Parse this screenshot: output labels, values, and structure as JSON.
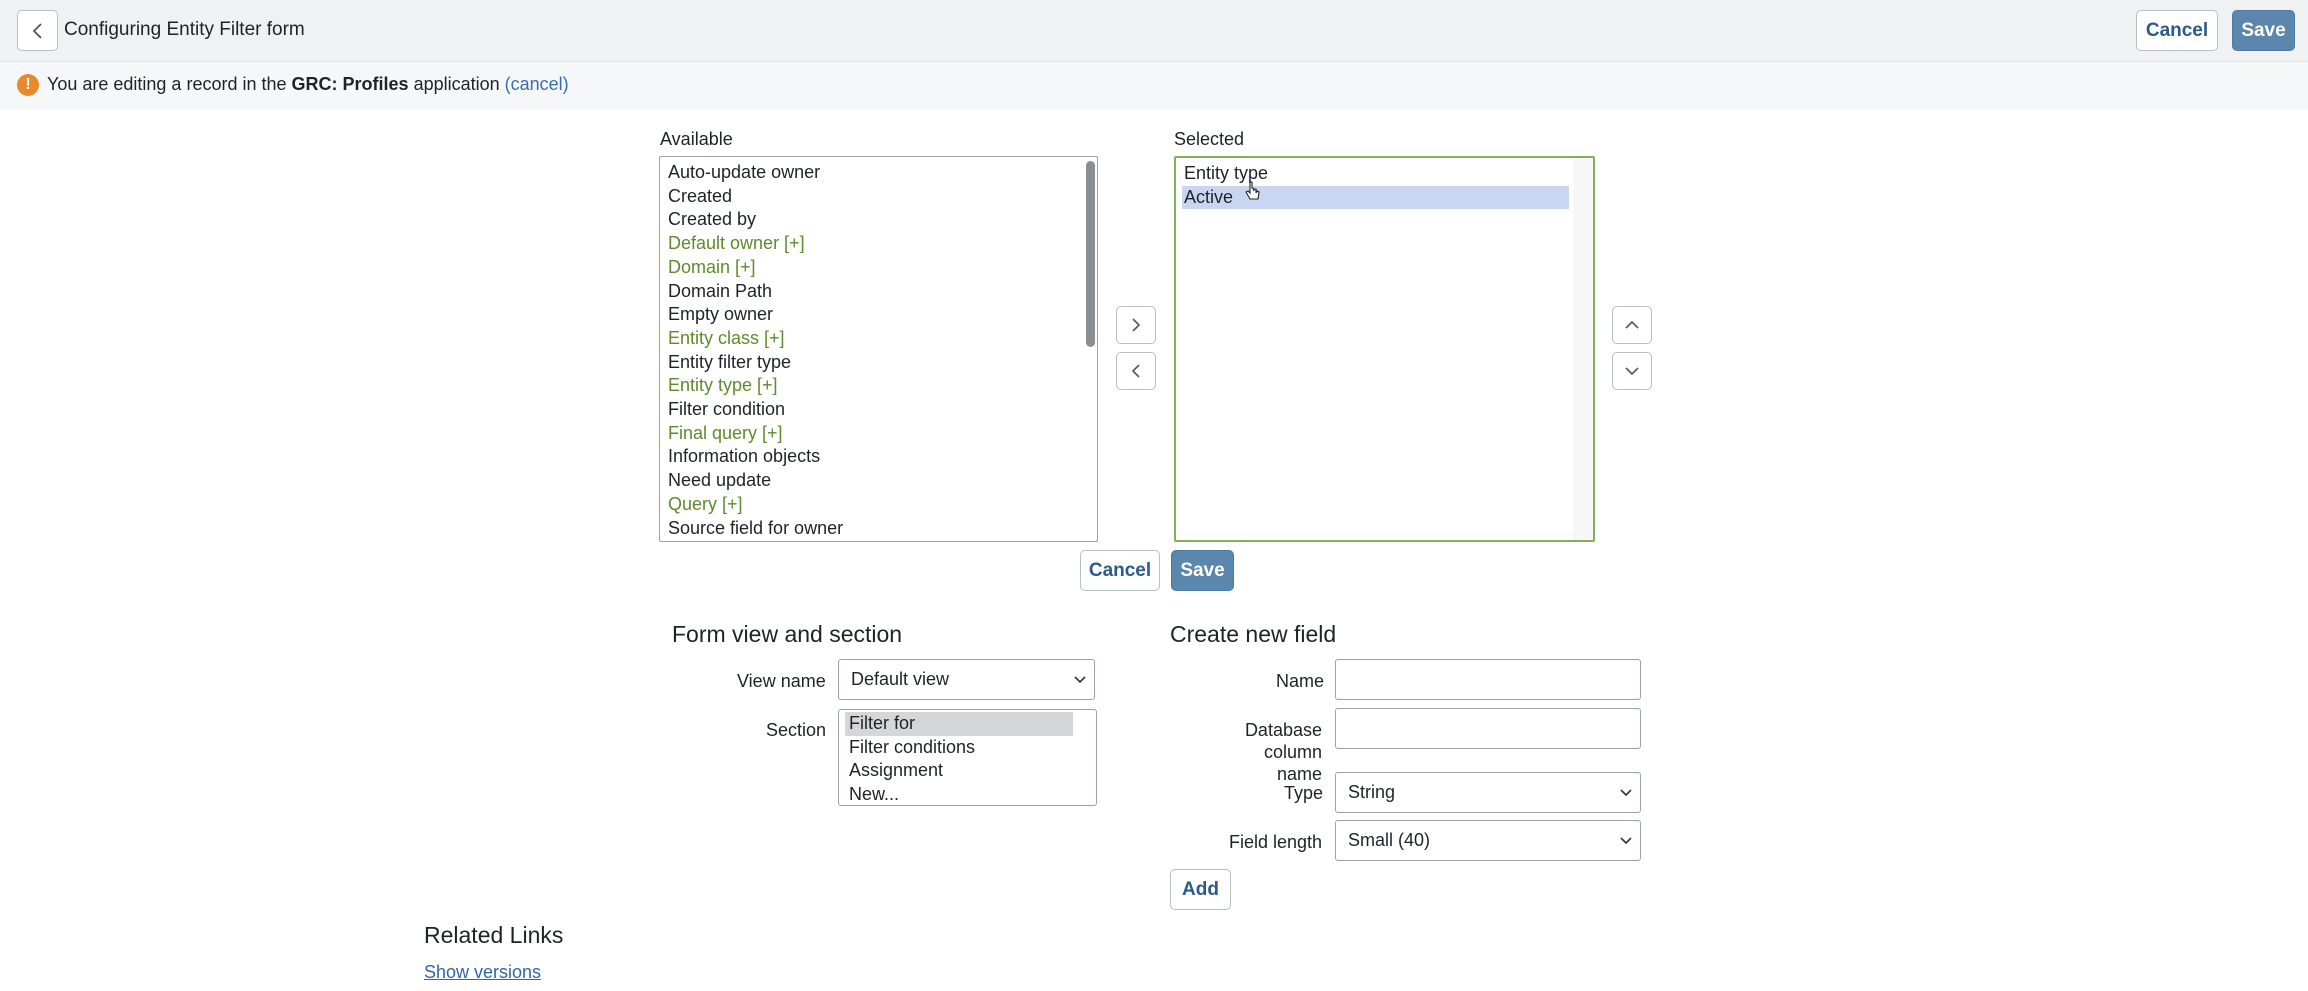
{
  "header": {
    "title": "Configuring Entity Filter form",
    "cancel_label": "Cancel",
    "save_label": "Save"
  },
  "notice": {
    "prefix": "You are editing a record in the",
    "app_name": "GRC: Profiles",
    "suffix": "application",
    "cancel_link": "(cancel)"
  },
  "slushbucket": {
    "available_label": "Available",
    "selected_label": "Selected",
    "available_items": [
      {
        "label": "Auto-update owner",
        "reference": false
      },
      {
        "label": "Created",
        "reference": false
      },
      {
        "label": "Created by",
        "reference": false
      },
      {
        "label": "Default owner [+]",
        "reference": true
      },
      {
        "label": "Domain [+]",
        "reference": true
      },
      {
        "label": "Domain Path",
        "reference": false
      },
      {
        "label": "Empty owner",
        "reference": false
      },
      {
        "label": "Entity class [+]",
        "reference": true
      },
      {
        "label": "Entity filter type",
        "reference": false
      },
      {
        "label": "Entity type [+]",
        "reference": true
      },
      {
        "label": "Filter condition",
        "reference": false
      },
      {
        "label": "Final query [+]",
        "reference": true
      },
      {
        "label": "Information objects",
        "reference": false
      },
      {
        "label": "Need update",
        "reference": false
      },
      {
        "label": "Query [+]",
        "reference": true
      },
      {
        "label": "Source field for owner",
        "reference": false
      }
    ],
    "selected_items": [
      {
        "label": "Entity type",
        "highlighted": false
      },
      {
        "label": "Active",
        "highlighted": true
      }
    ],
    "cancel_label": "Cancel",
    "save_label": "Save"
  },
  "form_view": {
    "title": "Form view and section",
    "view_name_label": "View name",
    "view_name_value": "Default view",
    "section_label": "Section",
    "sections": [
      "Filter for",
      "Filter conditions",
      "Assignment",
      "New..."
    ],
    "selected_section": "Filter for"
  },
  "create_field": {
    "title": "Create new field",
    "name_label": "Name",
    "name_value": "",
    "db_column_label_line1": "Database column",
    "db_column_label_line2": "name",
    "db_column_value": "",
    "type_label": "Type",
    "type_value": "String",
    "length_label": "Field length",
    "length_value": "Small (40)",
    "add_label": "Add"
  },
  "related_links": {
    "title": "Related Links",
    "show_versions": "Show versions"
  },
  "colors": {
    "primary": "#5b86ad",
    "reference_field": "#5e8b2c",
    "selected_border": "#7fb25a",
    "highlight": "#c8d6f2",
    "warning": "#e8892f"
  }
}
